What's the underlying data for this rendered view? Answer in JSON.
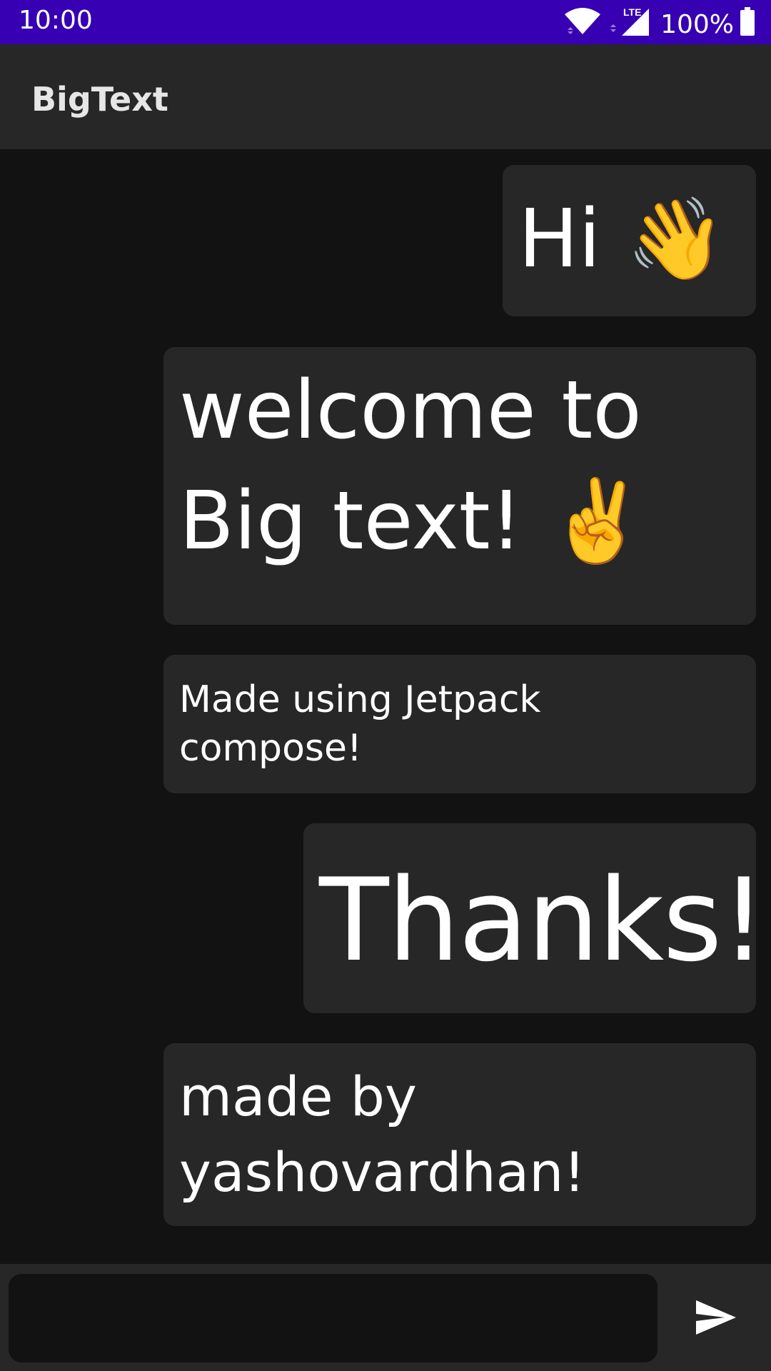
{
  "status_bar": {
    "time": "10:00",
    "network": "LTE",
    "battery": "100%",
    "icons": [
      "wifi-icon",
      "cell-signal-icon",
      "battery-icon"
    ],
    "background_color": "#3700B3"
  },
  "app_bar": {
    "title": "BigText"
  },
  "messages": [
    {
      "text": "Hi 👋"
    },
    {
      "text": "welcome to\nBig text! ✌️"
    },
    {
      "text": "Made using Jetpack\ncompose!"
    },
    {
      "text": "Thanks!"
    },
    {
      "text": "made by\nyashovardhan!"
    }
  ],
  "composer": {
    "value": "",
    "placeholder": "",
    "send_icon": "send-icon"
  },
  "colors": {
    "background": "#121212",
    "surface": "#272727",
    "text": "#ffffff"
  }
}
